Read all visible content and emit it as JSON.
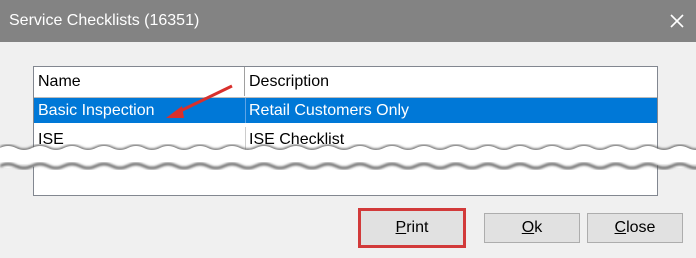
{
  "window": {
    "title": "Service Checklists (16351)",
    "close_icon": "close-icon"
  },
  "list": {
    "columns": [
      "Name",
      "Description"
    ],
    "rows": [
      {
        "name": "Basic Inspection",
        "description": "Retail Customers Only",
        "selected": true
      },
      {
        "name": "ISE",
        "description": "ISE Checklist",
        "selected": false
      }
    ]
  },
  "buttons": {
    "print": {
      "label": "Print",
      "mnemonic": "P"
    },
    "ok": {
      "label": "Ok",
      "mnemonic": "O"
    },
    "close": {
      "label": "Close",
      "mnemonic": "C"
    }
  },
  "colors": {
    "titlebar": "#838383",
    "selection": "#0078d7",
    "highlight": "#d23a3a"
  }
}
